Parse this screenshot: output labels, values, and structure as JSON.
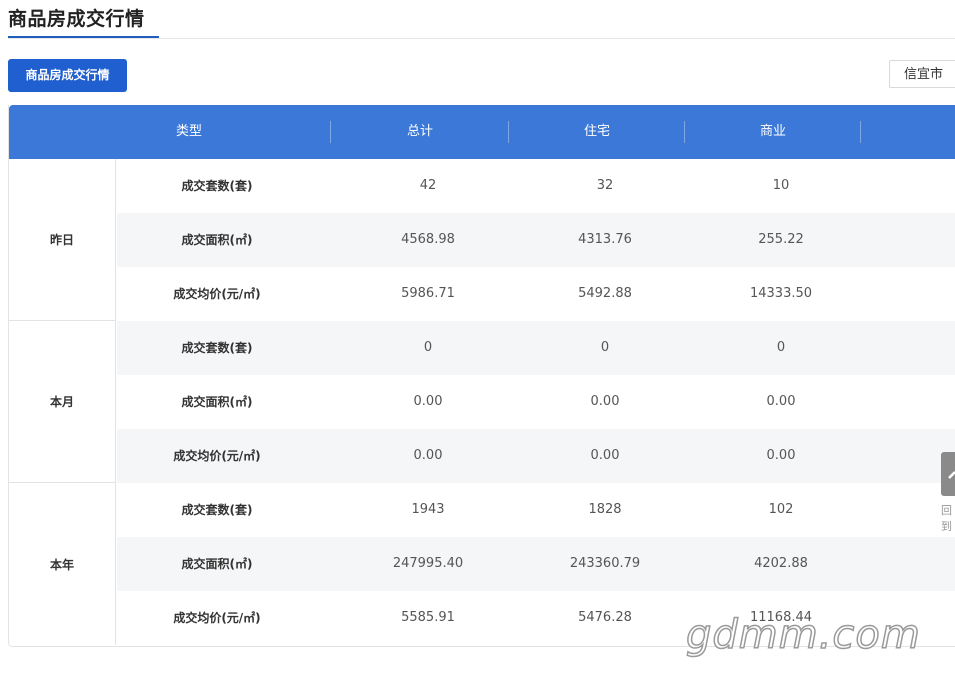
{
  "page": {
    "title": "商品房成交行情",
    "tab_label": "商品房成交行情",
    "city": "信宜市"
  },
  "table": {
    "headers": [
      "类型",
      "总计",
      "住宅",
      "商业"
    ],
    "groups": [
      {
        "period": "昨日",
        "rows": [
          {
            "metric": "成交套数(套)",
            "total": "42",
            "residential": "32",
            "commercial": "10"
          },
          {
            "metric": "成交面积(㎡)",
            "total": "4568.98",
            "residential": "4313.76",
            "commercial": "255.22"
          },
          {
            "metric": "成交均价(元/㎡)",
            "total": "5986.71",
            "residential": "5492.88",
            "commercial": "14333.50"
          }
        ]
      },
      {
        "period": "本月",
        "rows": [
          {
            "metric": "成交套数(套)",
            "total": "0",
            "residential": "0",
            "commercial": "0"
          },
          {
            "metric": "成交面积(㎡)",
            "total": "0.00",
            "residential": "0.00",
            "commercial": "0.00"
          },
          {
            "metric": "成交均价(元/㎡)",
            "total": "0.00",
            "residential": "0.00",
            "commercial": "0.00"
          }
        ]
      },
      {
        "period": "本年",
        "rows": [
          {
            "metric": "成交套数(套)",
            "total": "1943",
            "residential": "1828",
            "commercial": "102"
          },
          {
            "metric": "成交面积(㎡)",
            "total": "247995.40",
            "residential": "243360.79",
            "commercial": "4202.88"
          },
          {
            "metric": "成交均价(元/㎡)",
            "total": "5585.91",
            "residential": "5476.28",
            "commercial": "11168.44"
          }
        ]
      }
    ]
  },
  "back_to_top": {
    "label": "回到"
  },
  "watermark": "gdmm.com"
}
